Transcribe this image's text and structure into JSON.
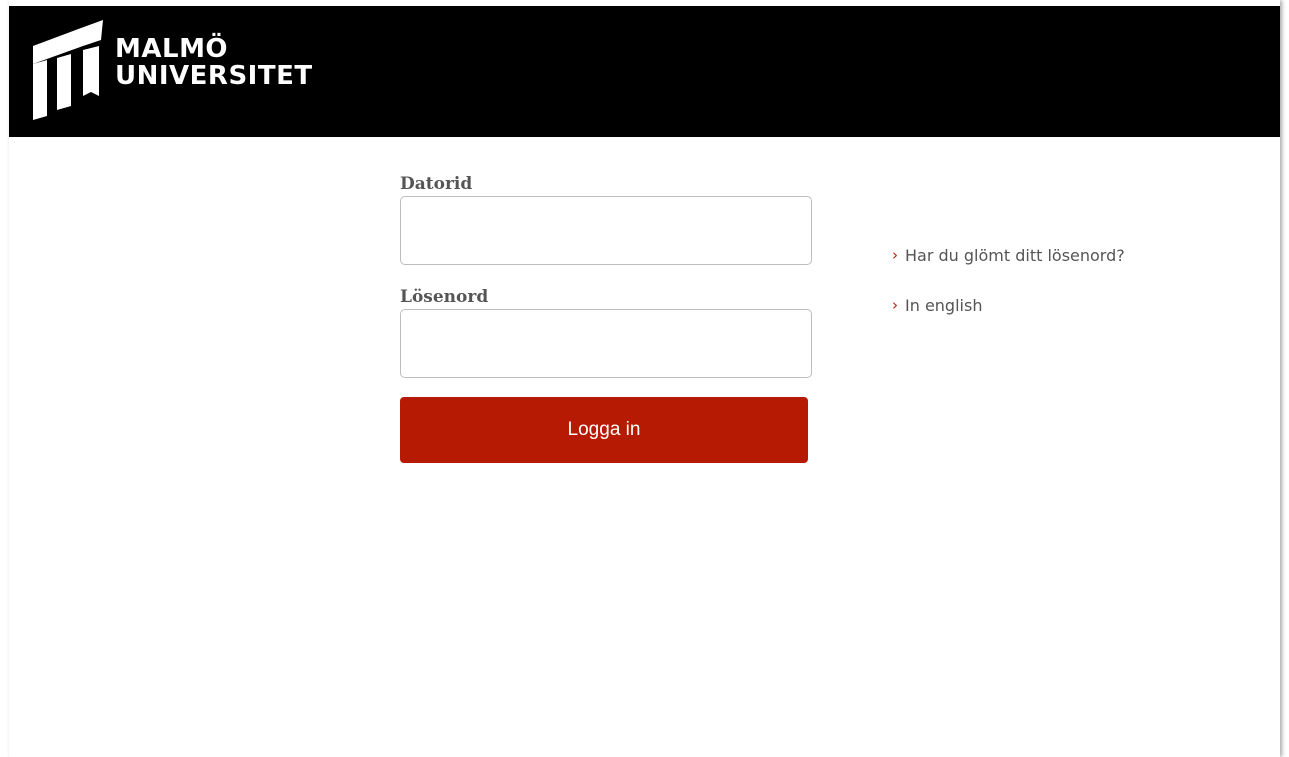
{
  "brand": {
    "line1": "MALMÖ",
    "line2": "UNIVERSITET",
    "logo_icon": "malmo-university-logo-mark"
  },
  "form": {
    "username_label": "Datorid",
    "username_value": "",
    "password_label": "Lösenord",
    "password_value": "",
    "submit_label": "Logga in"
  },
  "links": [
    {
      "icon": "chevron-right-icon",
      "glyph": "›",
      "label": "Har du glömt ditt lösenord?"
    },
    {
      "icon": "chevron-right-icon",
      "glyph": "›",
      "label": "In english"
    }
  ],
  "colors": {
    "header_bg": "#000000",
    "accent": "#b71a03",
    "label_text": "#555555"
  }
}
